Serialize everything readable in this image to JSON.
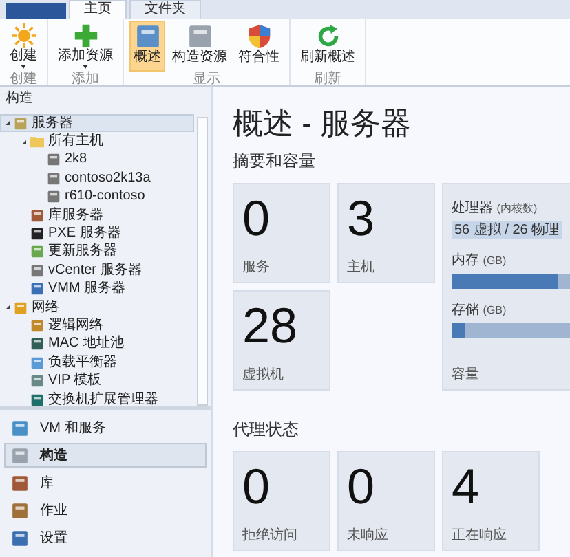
{
  "ribbon": {
    "tabs": [
      {
        "label": "主页",
        "selected": true
      },
      {
        "label": "文件夹",
        "selected": false
      }
    ],
    "groups": [
      {
        "label": "创建",
        "buttons": [
          {
            "label": "创建",
            "dropdown": true,
            "selected": false
          }
        ]
      },
      {
        "label": "添加",
        "buttons": [
          {
            "label": "添加资源",
            "dropdown": true,
            "selected": false
          }
        ]
      },
      {
        "label": "显示",
        "buttons": [
          {
            "label": "概述",
            "dropdown": false,
            "selected": true
          },
          {
            "label": "构造资源",
            "dropdown": false,
            "selected": false
          },
          {
            "label": "符合性",
            "dropdown": false,
            "selected": false
          }
        ]
      },
      {
        "label": "刷新",
        "buttons": [
          {
            "label": "刷新概述",
            "dropdown": false,
            "selected": false
          }
        ]
      }
    ]
  },
  "sidebar": {
    "title": "构造",
    "tree": [
      {
        "label": "服务器",
        "expanded": true,
        "selected": true,
        "children": [
          {
            "label": "所有主机",
            "expanded": true,
            "selected": false,
            "children": [
              {
                "label": "2k8",
                "selected": false
              },
              {
                "label": "contoso2k13a",
                "selected": false
              },
              {
                "label": "r610-contoso",
                "selected": false
              }
            ]
          },
          {
            "label": "库服务器",
            "selected": false
          },
          {
            "label": "PXE 服务器",
            "selected": false
          },
          {
            "label": "更新服务器",
            "selected": false
          },
          {
            "label": "vCenter 服务器",
            "selected": false
          },
          {
            "label": "VMM 服务器",
            "selected": false
          }
        ]
      },
      {
        "label": "网络",
        "expanded": true,
        "selected": false,
        "children": [
          {
            "label": "逻辑网络",
            "selected": false
          },
          {
            "label": "MAC 地址池",
            "selected": false
          },
          {
            "label": "负载平衡器",
            "selected": false
          },
          {
            "label": "VIP 模板",
            "selected": false
          },
          {
            "label": "交换机扩展管理器",
            "selected": false
          }
        ]
      }
    ],
    "nav": [
      {
        "label": "VM 和服务",
        "selected": false
      },
      {
        "label": "构造",
        "selected": true
      },
      {
        "label": "库",
        "selected": false
      },
      {
        "label": "作业",
        "selected": false
      },
      {
        "label": "设置",
        "selected": false
      }
    ]
  },
  "content": {
    "title": "概述 - 服务器",
    "summary": {
      "heading": "摘要和容量",
      "tiles": [
        {
          "value": "0",
          "label": "服务"
        },
        {
          "value": "3",
          "label": "主机"
        },
        {
          "value": "28",
          "label": "虚拟机"
        }
      ],
      "capacity": {
        "label": "容量",
        "meters": [
          {
            "name": "处理器",
            "unit": "(内核数)",
            "kind": "text",
            "reading": "56 虚拟 / 26 物理"
          },
          {
            "name": "内存",
            "unit": "(GB)",
            "kind": "bar",
            "level": 0.9
          },
          {
            "name": "存储",
            "unit": "(GB)",
            "kind": "bar",
            "level": 0.12
          }
        ]
      }
    },
    "agents": {
      "heading": "代理状态",
      "tiles": [
        {
          "value": "0",
          "label": "拒绝访问"
        },
        {
          "value": "0",
          "label": "未响应"
        },
        {
          "value": "4",
          "label": "正在响应"
        }
      ]
    }
  }
}
